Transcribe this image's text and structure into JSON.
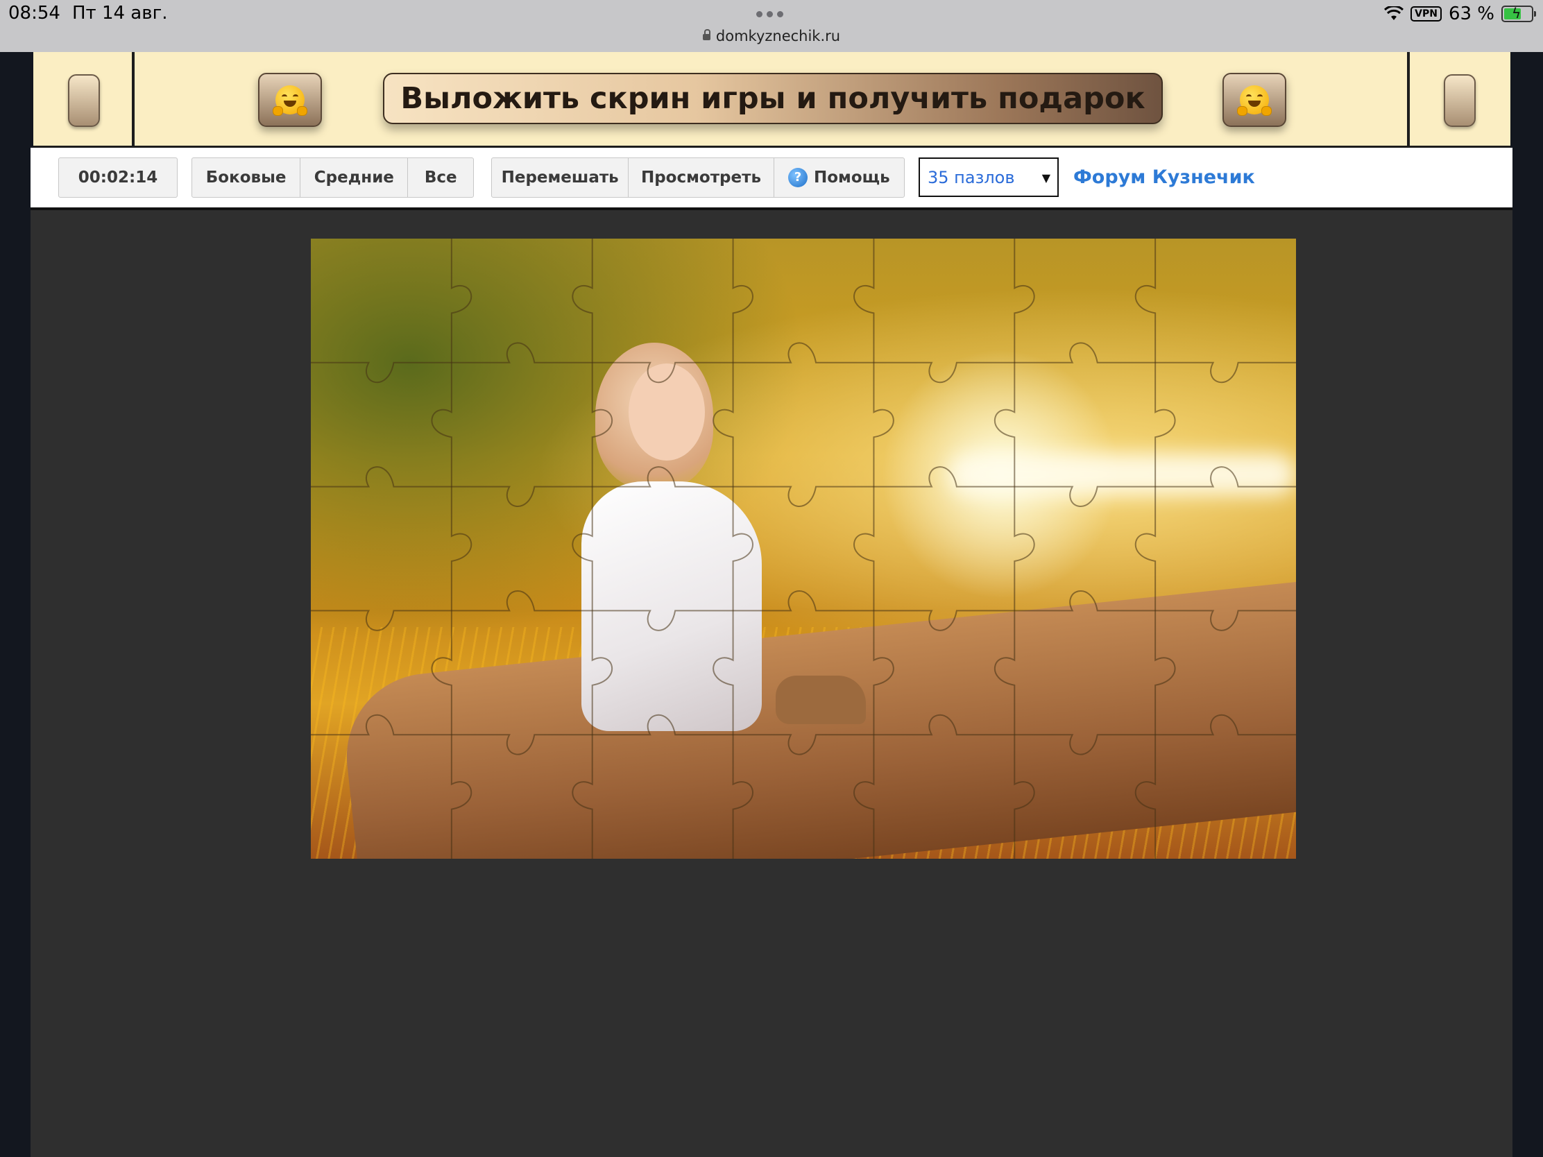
{
  "status_bar": {
    "time": "08:54",
    "date": "Пт 14 авг.",
    "url": "domkyznechik.ru",
    "vpn": "VPN",
    "battery": "63 %"
  },
  "banner": {
    "title": "Выложить скрин игры и получить подарок",
    "left_emoji": "hugging-face-icon",
    "right_emoji": "hugging-face-icon"
  },
  "toolbar": {
    "timer": "00:02:14",
    "filter_buttons": [
      "Боковые",
      "Средние",
      "Все"
    ],
    "shuffle": "Перемешать",
    "preview": "Просмотреть",
    "help": "Помощь",
    "pieces_select": "35 пазлов",
    "forum_link": "Форум Кузнечик"
  },
  "puzzle": {
    "columns": 7,
    "rows": 5
  },
  "colors": {
    "banner_bg": "#fbeec3",
    "play_bg": "#2f2f2f",
    "link": "#2d7ad6"
  }
}
